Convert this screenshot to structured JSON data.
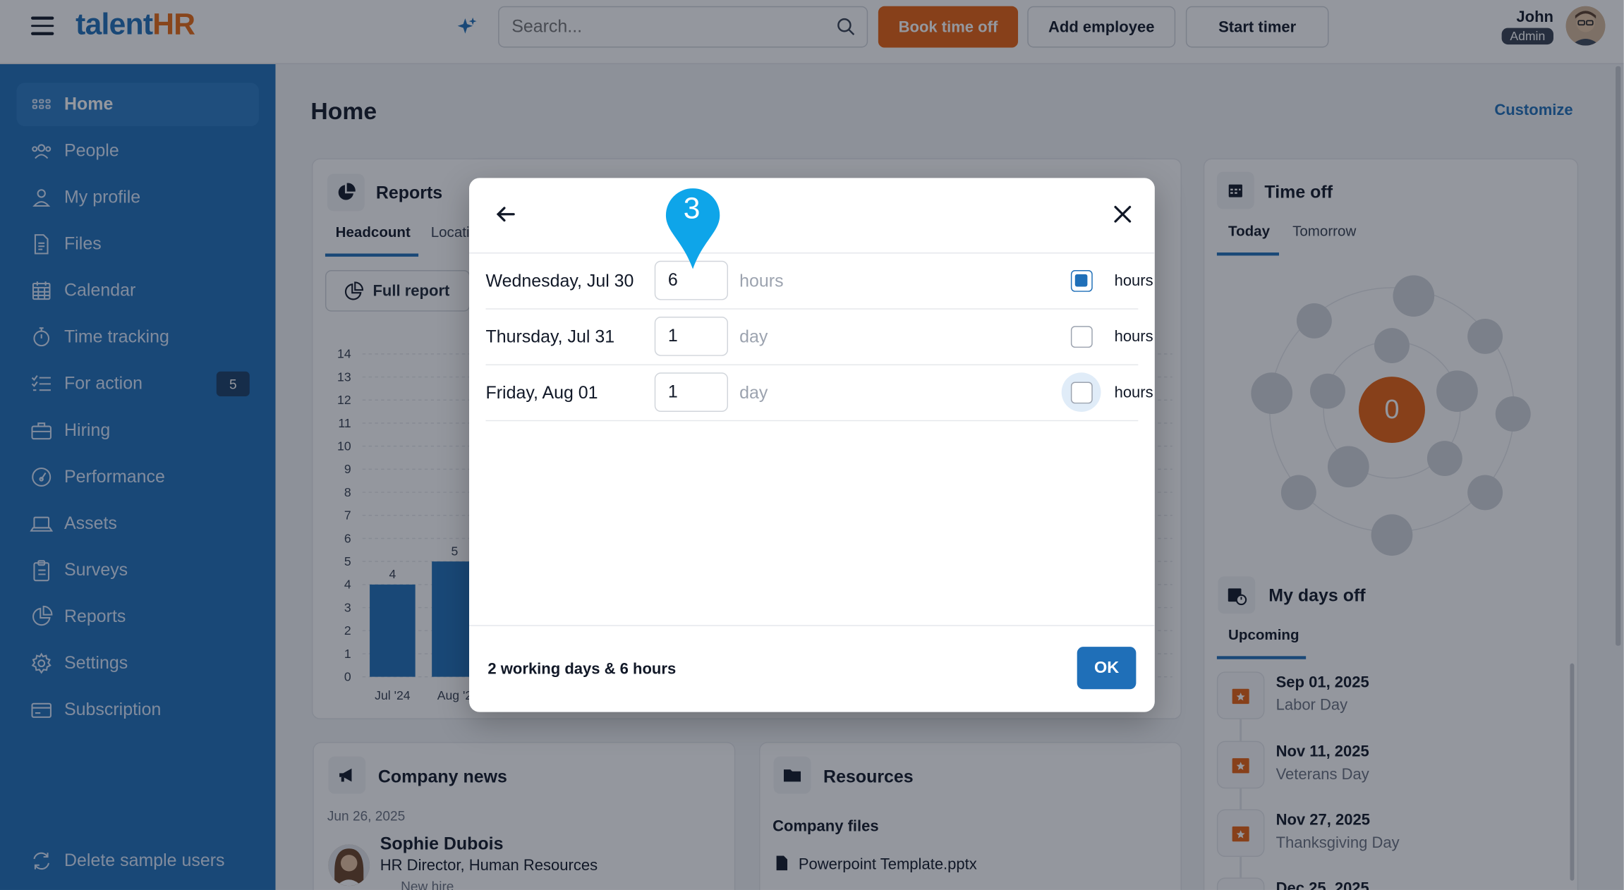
{
  "header": {
    "logo_part1": "talent",
    "logo_part2": "HR",
    "search_placeholder": "Search...",
    "book_time_off": "Book time off",
    "add_employee": "Add employee",
    "start_timer": "Start timer",
    "user_name": "John",
    "user_role": "Admin"
  },
  "sidebar": {
    "items": [
      {
        "label": "Home",
        "icon": "grid-icon"
      },
      {
        "label": "People",
        "icon": "people-icon"
      },
      {
        "label": "My profile",
        "icon": "user-icon"
      },
      {
        "label": "Files",
        "icon": "file-icon"
      },
      {
        "label": "Calendar",
        "icon": "calendar-icon"
      },
      {
        "label": "Time tracking",
        "icon": "stopwatch-icon"
      },
      {
        "label": "For action",
        "icon": "checklist-icon",
        "badge": "5"
      },
      {
        "label": "Hiring",
        "icon": "briefcase-icon"
      },
      {
        "label": "Performance",
        "icon": "gauge-icon"
      },
      {
        "label": "Assets",
        "icon": "laptop-icon"
      },
      {
        "label": "Surveys",
        "icon": "clipboard-icon"
      },
      {
        "label": "Reports",
        "icon": "pie-chart-icon"
      },
      {
        "label": "Settings",
        "icon": "gear-icon"
      },
      {
        "label": "Subscription",
        "icon": "card-icon"
      }
    ],
    "delete_sample": "Delete sample users"
  },
  "main": {
    "title": "Home",
    "customize": "Customize",
    "reports": {
      "title": "Reports",
      "tabs": [
        "Headcount",
        "Locati"
      ],
      "full_report": "Full report"
    },
    "company_news": {
      "title": "Company news",
      "date": "Jun 26, 2025",
      "person": "Sophie Dubois",
      "role": "HR Director, Human Resources",
      "note": "New hire"
    },
    "resources": {
      "title": "Resources",
      "section": "Company files",
      "file": "Powerpoint Template.pptx"
    },
    "time_off": {
      "title": "Time off",
      "tabs": [
        "Today",
        "Tomorrow"
      ],
      "count": "0"
    },
    "my_days_off": {
      "title": "My days off",
      "tab": "Upcoming",
      "holidays": [
        {
          "date": "Sep 01, 2025",
          "name": "Labor Day"
        },
        {
          "date": "Nov 11, 2025",
          "name": "Veterans Day"
        },
        {
          "date": "Nov 27, 2025",
          "name": "Thanksgiving Day"
        },
        {
          "date": "Dec 25, 2025",
          "name": ""
        }
      ]
    }
  },
  "chart_data": {
    "type": "bar",
    "categories": [
      "Jul '24",
      "Aug '2"
    ],
    "values": [
      4,
      5
    ],
    "ylim": [
      0,
      14
    ],
    "yticks": [
      "0",
      "1",
      "2",
      "3",
      "4",
      "5",
      "6",
      "7",
      "8",
      "9",
      "10",
      "11",
      "12",
      "13",
      "14"
    ],
    "title": "",
    "xlabel": "",
    "ylabel": "",
    "bar_color": "#1f6fb8"
  },
  "dialog": {
    "rows": [
      {
        "day": "Wednesday, Jul 30",
        "value": "6",
        "unit": "hours",
        "checkbox_label": "hours",
        "checked": true
      },
      {
        "day": "Thursday, Jul 31",
        "value": "1",
        "unit": "day",
        "checkbox_label": "hours",
        "checked": false
      },
      {
        "day": "Friday, Aug 01",
        "value": "1",
        "unit": "day",
        "checkbox_label": "hours",
        "checked": false
      }
    ],
    "summary": "2 working days & 6 hours",
    "ok": "OK",
    "step_marker": "3"
  },
  "colors": {
    "brand_blue": "#1f6fb8",
    "brand_orange": "#e8620f",
    "marker_blue": "#0ea5e9"
  }
}
